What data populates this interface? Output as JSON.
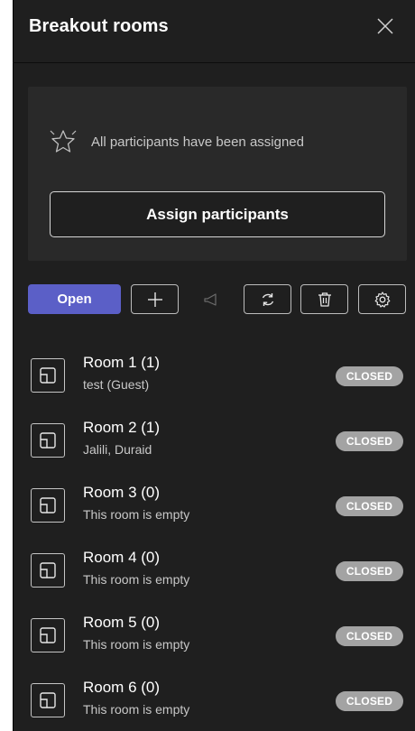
{
  "panel": {
    "title": "Breakout rooms"
  },
  "assign": {
    "status_text": "All participants have been assigned",
    "button_label": "Assign participants"
  },
  "toolbar": {
    "open_label": "Open",
    "add_icon": "plus-icon",
    "announce_icon": "megaphone-icon",
    "recreate_icon": "refresh-icon",
    "delete_icon": "trash-icon",
    "settings_icon": "gear-icon"
  },
  "rooms": [
    {
      "name": "Room 1  (1)",
      "subtitle": "test (Guest)",
      "status": "CLOSED"
    },
    {
      "name": "Room 2  (1)",
      "subtitle": "Jalili, Duraid",
      "status": "CLOSED"
    },
    {
      "name": "Room 3  (0)",
      "subtitle": "This room is empty",
      "status": "CLOSED"
    },
    {
      "name": "Room 4  (0)",
      "subtitle": "This room is empty",
      "status": "CLOSED"
    },
    {
      "name": "Room 5  (0)",
      "subtitle": "This room is empty",
      "status": "CLOSED"
    },
    {
      "name": "Room 6  (0)",
      "subtitle": "This room is empty",
      "status": "CLOSED"
    }
  ],
  "colors": {
    "panel_bg": "#1f1f1f",
    "card_bg": "#292929",
    "accent": "#5b5fc7",
    "badge_bg": "#a3a3a3"
  }
}
